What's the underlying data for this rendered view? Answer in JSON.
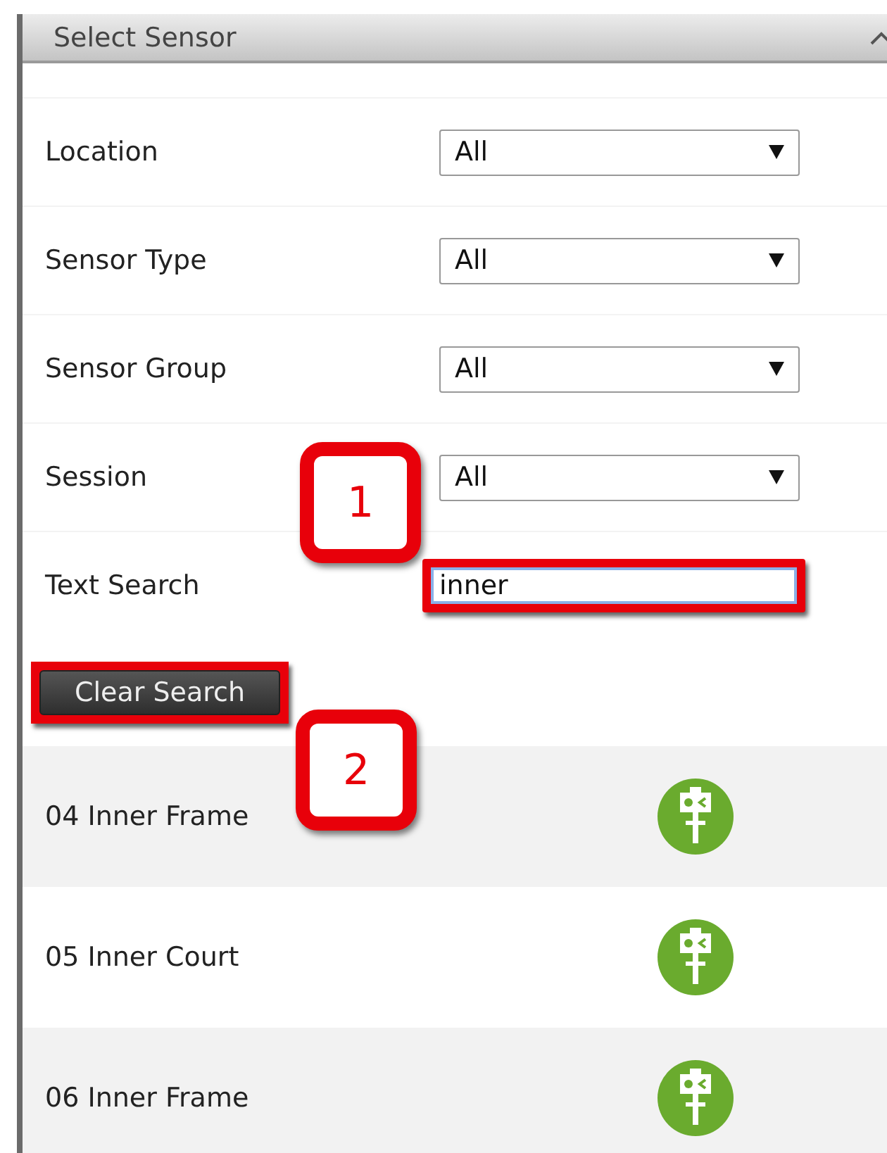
{
  "panel": {
    "title": "Select Sensor",
    "expanded": true
  },
  "filters": [
    {
      "kind": "select",
      "label": "Location",
      "value": "All"
    },
    {
      "kind": "select",
      "label": "Sensor Type",
      "value": "All"
    },
    {
      "kind": "select",
      "label": "Sensor Group",
      "value": "All"
    },
    {
      "kind": "select",
      "label": "Session",
      "value": "All"
    },
    {
      "kind": "text",
      "label": "Text Search",
      "value": "inner",
      "highlighted": true
    }
  ],
  "clear_button": {
    "label": "Clear Search",
    "highlighted": true
  },
  "sensors": [
    {
      "name": "04 Inner Frame"
    },
    {
      "name": "05 Inner Court"
    },
    {
      "name": "06 Inner Frame"
    }
  ],
  "callouts": [
    {
      "label": "1"
    },
    {
      "label": "2"
    }
  ]
}
